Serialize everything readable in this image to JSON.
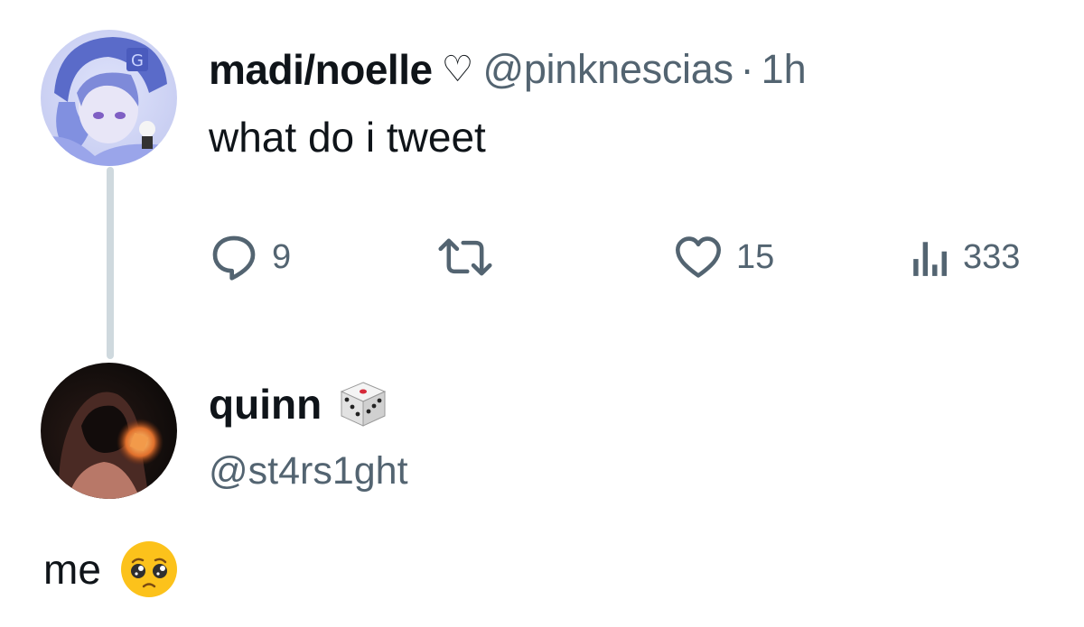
{
  "tweet": {
    "display_name": "madi/noelle",
    "name_emoji": "♡",
    "handle": "@pinknescias",
    "separator": "·",
    "time": "1h",
    "text": "what do i tweet",
    "actions": {
      "reply_count": "9",
      "retweet_count": "",
      "like_count": "15",
      "view_count": "333"
    }
  },
  "reply_user": {
    "display_name": "quinn",
    "name_emoji_icon": "dice-icon",
    "handle": "@st4rs1ght"
  },
  "reply": {
    "text": "me",
    "emoji_icon": "pleading-face-icon"
  },
  "colors": {
    "text_primary": "#0f1419",
    "text_secondary": "#536471",
    "thread_line": "#cfd9de",
    "avatar1_accent": "#7b86d8",
    "avatar2_accent": "#e07a4a"
  }
}
